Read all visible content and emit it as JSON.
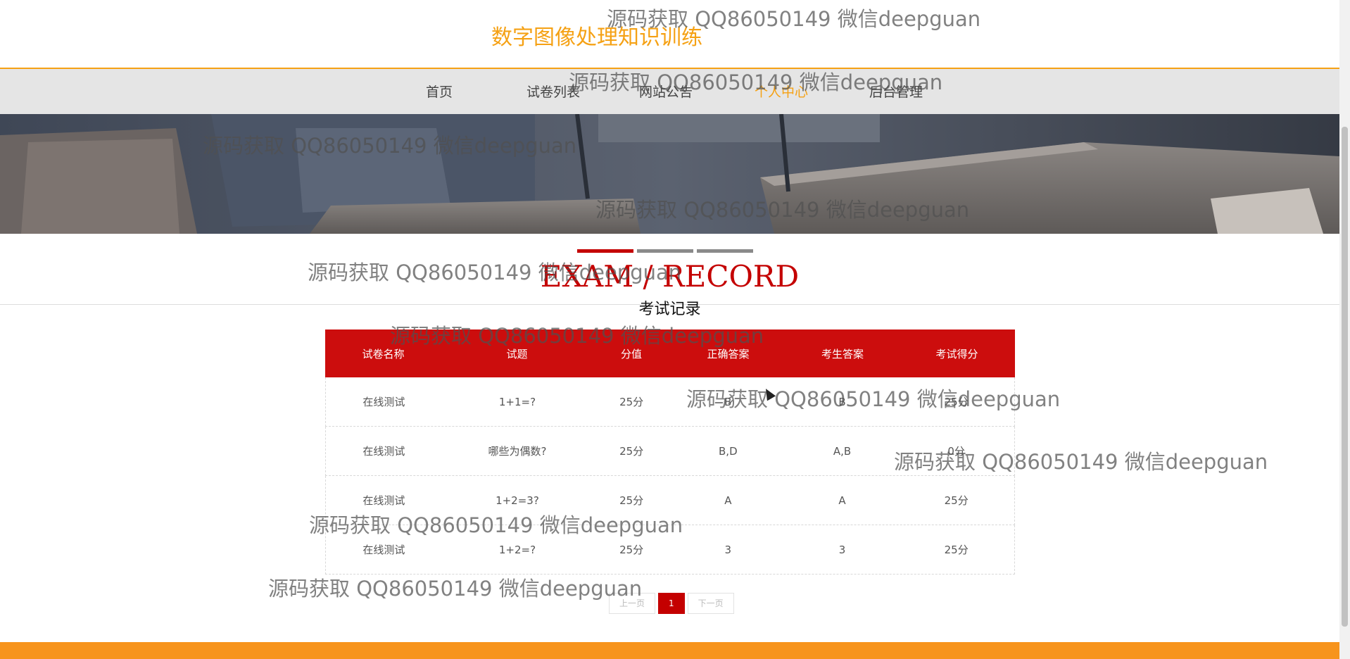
{
  "site": {
    "title": "数字图像处理知识训练"
  },
  "nav": {
    "items": [
      {
        "label": "首页",
        "active": false
      },
      {
        "label": "试卷列表",
        "active": false
      },
      {
        "label": "网站公告",
        "active": false
      },
      {
        "label": "个人中心",
        "active": true
      },
      {
        "label": "后台管理",
        "active": false
      }
    ]
  },
  "section": {
    "title_en": "EXAM / RECORD",
    "title_cn": "考试记录"
  },
  "table": {
    "headers": [
      "试卷名称",
      "试题",
      "分值",
      "正确答案",
      "考生答案",
      "考试得分"
    ],
    "rows": [
      [
        "在线测试",
        "1+1=?",
        "25分",
        "B",
        "B",
        "25分"
      ],
      [
        "在线测试",
        "哪些为偶数?",
        "25分",
        "B,D",
        "A,B",
        "0分"
      ],
      [
        "在线测试",
        "1+2=3?",
        "25分",
        "A",
        "A",
        "25分"
      ],
      [
        "在线测试",
        "1+2=?",
        "25分",
        "3",
        "3",
        "25分"
      ]
    ]
  },
  "pagination": {
    "prev": "上一页",
    "current": "1",
    "next": "下一页"
  },
  "watermark": "源码获取 QQ86050149 微信deepguan",
  "colors": {
    "accent": "#f5a114",
    "brand_red": "#cc0d0d"
  }
}
